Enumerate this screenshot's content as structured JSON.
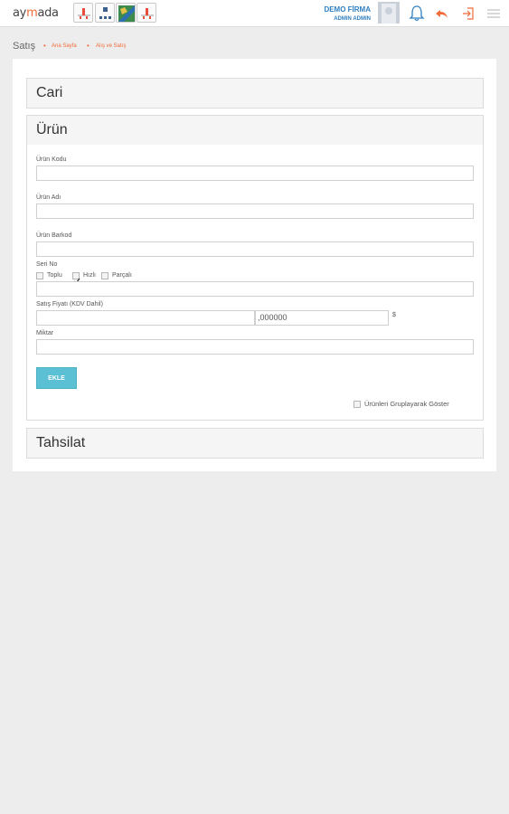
{
  "header": {
    "logo_prefix": "ay",
    "logo_accent": "m",
    "logo_suffix": "ada",
    "company_name": "DEMO FİRMA",
    "user_name": "ADMIN ADMIN",
    "accent_color": "#f26b3a",
    "link_color": "#2f7fc1",
    "icons": [
      "chart-app-icon",
      "grid-app-icon",
      "map-app-icon",
      "chart-app-icon",
      "bell-icon",
      "undo-icon",
      "logout-icon",
      "menu-icon"
    ]
  },
  "breadcrumb": {
    "title": "Satış",
    "items": [
      "Ana Sayfa",
      "Alış ve Satış"
    ]
  },
  "sections": {
    "cari": {
      "title": "Cari"
    },
    "urun": {
      "title": "Ürün",
      "fields": {
        "urun_kodu": {
          "label": "Ürün Kodu",
          "value": ""
        },
        "urun_adi": {
          "label": "Ürün Adı",
          "value": ""
        },
        "urun_barkod": {
          "label": "Ürün Barkod",
          "value": ""
        },
        "seri_no": {
          "label": "Seri No",
          "value": ""
        },
        "satis_fiyati": {
          "label": "Satış Fiyatı (KDV Dahil)",
          "integer_value": "",
          "decimal_value": ",000000",
          "currency": "$"
        },
        "miktar": {
          "label": "Miktar",
          "value": ""
        }
      },
      "seri_options": [
        {
          "label": "Toplu",
          "checked": false
        },
        {
          "label": "Hızlı",
          "checked": true
        },
        {
          "label": "Parçalı",
          "checked": false
        }
      ],
      "add_button": "EKLE",
      "group_option": {
        "label": "Ürünleri Gruplayarak Göster",
        "checked": false
      }
    },
    "tahsilat": {
      "title": "Tahsilat"
    }
  }
}
